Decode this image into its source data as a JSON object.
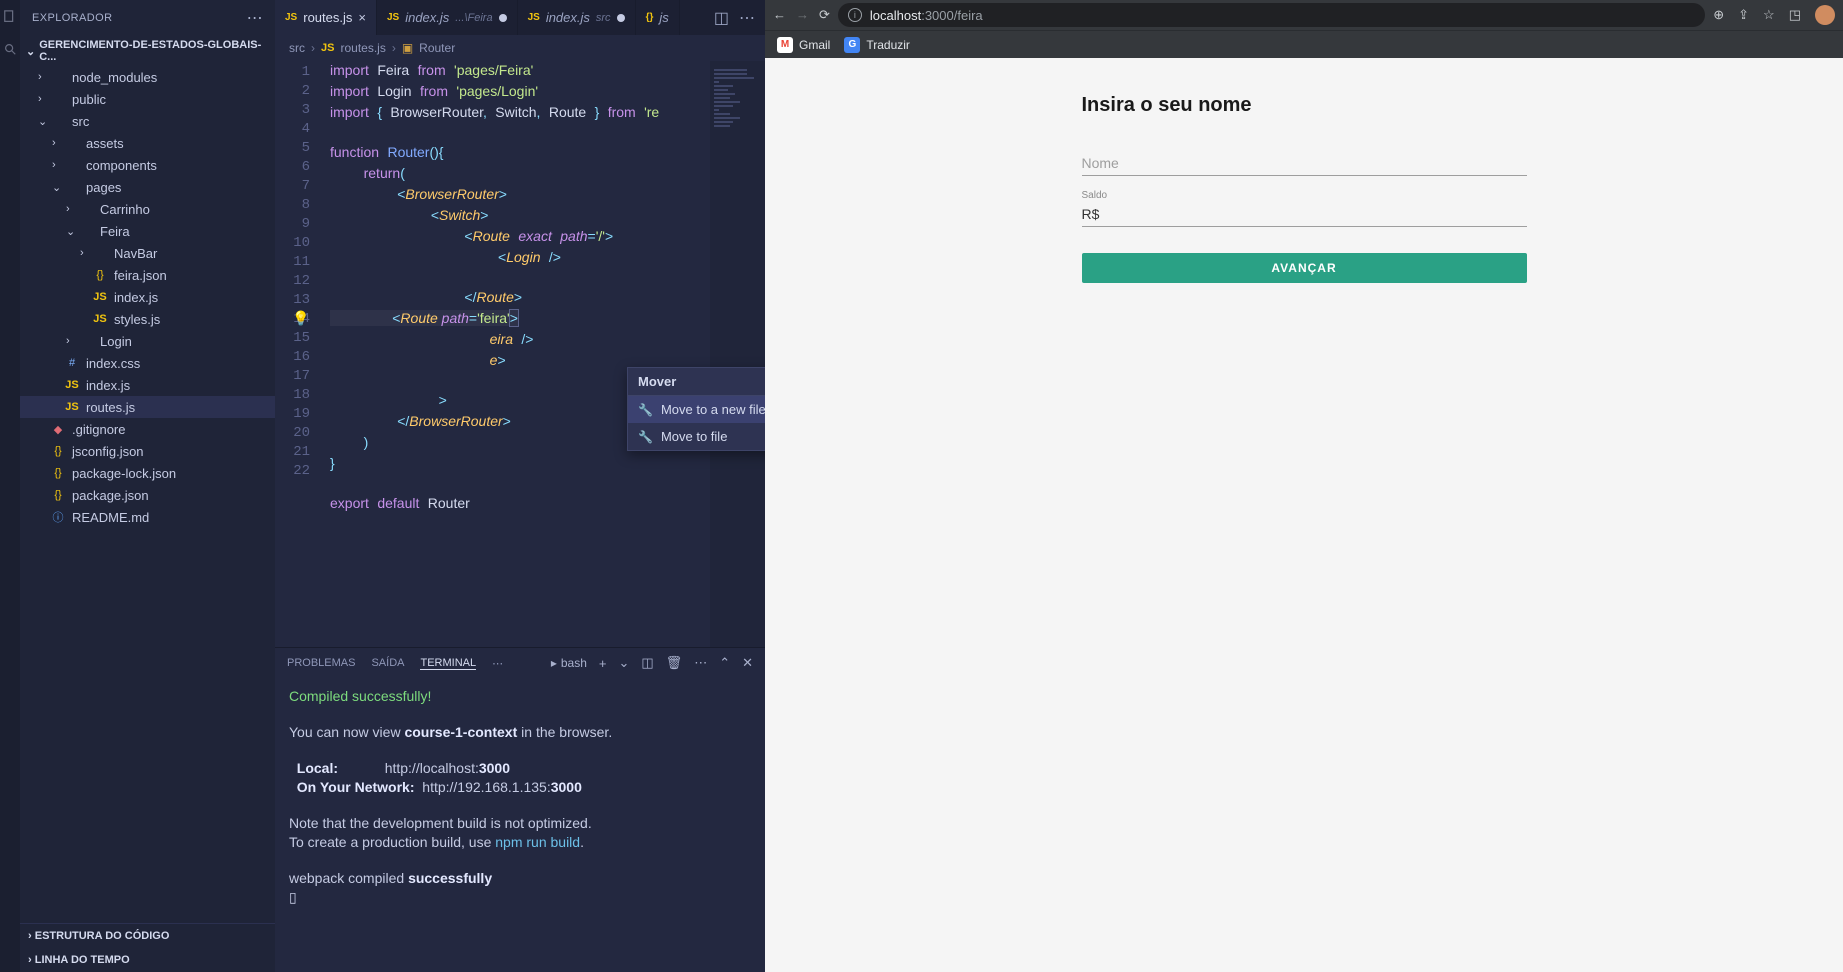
{
  "sidebar": {
    "header": "EXPLORADOR",
    "project": "GERENCIMENTO-DE-ESTADOS-GLOBAIS-C...",
    "tree": [
      {
        "depth": 0,
        "chev": "›",
        "icon": "",
        "name": "node_modules"
      },
      {
        "depth": 0,
        "chev": "›",
        "icon": "",
        "name": "public"
      },
      {
        "depth": 0,
        "chev": "⌄",
        "icon": "",
        "name": "src"
      },
      {
        "depth": 1,
        "chev": "›",
        "icon": "",
        "name": "assets"
      },
      {
        "depth": 1,
        "chev": "›",
        "icon": "",
        "name": "components"
      },
      {
        "depth": 1,
        "chev": "⌄",
        "icon": "",
        "name": "pages"
      },
      {
        "depth": 2,
        "chev": "›",
        "icon": "",
        "name": "Carrinho"
      },
      {
        "depth": 2,
        "chev": "⌄",
        "icon": "",
        "name": "Feira"
      },
      {
        "depth": 3,
        "chev": "›",
        "icon": "",
        "name": "NavBar"
      },
      {
        "depth": 3,
        "chev": "",
        "icon": "{}",
        "iconCls": "fjson",
        "name": "feira.json"
      },
      {
        "depth": 3,
        "chev": "",
        "icon": "JS",
        "iconCls": "fjs",
        "name": "index.js"
      },
      {
        "depth": 3,
        "chev": "",
        "icon": "JS",
        "iconCls": "fjs",
        "name": "styles.js"
      },
      {
        "depth": 2,
        "chev": "›",
        "icon": "",
        "name": "Login"
      },
      {
        "depth": 1,
        "chev": "",
        "icon": "#",
        "iconCls": "fcss",
        "name": "index.css"
      },
      {
        "depth": 1,
        "chev": "",
        "icon": "JS",
        "iconCls": "fjs",
        "name": "index.js"
      },
      {
        "depth": 1,
        "chev": "",
        "icon": "JS",
        "iconCls": "fjs",
        "name": "routes.js",
        "sel": true
      },
      {
        "depth": 0,
        "chev": "",
        "icon": "◆",
        "iconCls": "fgit",
        "name": ".gitignore"
      },
      {
        "depth": 0,
        "chev": "",
        "icon": "{}",
        "iconCls": "fjson",
        "name": "jsconfig.json"
      },
      {
        "depth": 0,
        "chev": "",
        "icon": "{}",
        "iconCls": "fjson",
        "name": "package-lock.json"
      },
      {
        "depth": 0,
        "chev": "",
        "icon": "{}",
        "iconCls": "fjson",
        "name": "package.json"
      },
      {
        "depth": 0,
        "chev": "",
        "icon": "ⓘ",
        "iconCls": "finfo",
        "name": "README.md"
      }
    ],
    "footer1": "ESTRUTURA DO CÓDIGO",
    "footer2": "LINHA DO TEMPO"
  },
  "tabs": [
    {
      "icon": "JS",
      "label": "routes.js",
      "active": true,
      "close": true
    },
    {
      "icon": "JS",
      "label": "index.js",
      "suffix": "...\\Feira",
      "dirty": true
    },
    {
      "icon": "JS",
      "label": "index.js",
      "suffix": "src",
      "dirty": true
    },
    {
      "icon": "{}",
      "label": "js",
      "partial": true
    }
  ],
  "breadcrumb": {
    "p1": "src",
    "p2": "routes.js",
    "p3": "Router"
  },
  "code_lines": 22,
  "context_menu": {
    "title": "Mover",
    "item1": "Move to a new file",
    "item2": "Move to file"
  },
  "panel": {
    "problems": "PROBLEMAS",
    "output": "SAÍDA",
    "terminal": "TERMINAL",
    "shell": "bash",
    "line1": "Compiled successfully!",
    "line2a": "You can now view ",
    "line2b": "course-1-context",
    "line2c": " in the browser.",
    "line3a": "  Local:",
    "line3b": "            http://localhost:",
    "line3c": "3000",
    "line4a": "  On Your Network:",
    "line4b": "  http://192.168.1.135:",
    "line4c": "3000",
    "line5": "Note that the development build is not optimized.",
    "line6a": "To create a production build, use ",
    "line6b": "npm run build",
    "line6c": ".",
    "line7a": "webpack compiled ",
    "line7b": "successfully",
    "cursor": "▯"
  },
  "browser": {
    "url_host": "localhost",
    "url_port": ":3000",
    "url_path": "/feira",
    "bm_gmail": "Gmail",
    "bm_translate": "Traduzir",
    "page_title": "Insira o seu nome",
    "label_nome": "",
    "ph_nome": "Nome",
    "label_saldo": "Saldo",
    "val_saldo": "R$",
    "submit": "AVANÇAR"
  }
}
